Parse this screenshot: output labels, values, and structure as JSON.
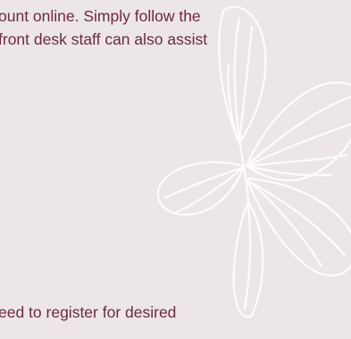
{
  "content": {
    "paragraph_top": [
      "ount online. Simply follow the",
      "front desk staff can also assist"
    ],
    "paragraph_bottom": "eed to register for desired"
  },
  "decoration": {
    "icon": "butterfly-watermark-icon",
    "background_color": "#ece6e7",
    "text_color": "#6d2a3e"
  }
}
